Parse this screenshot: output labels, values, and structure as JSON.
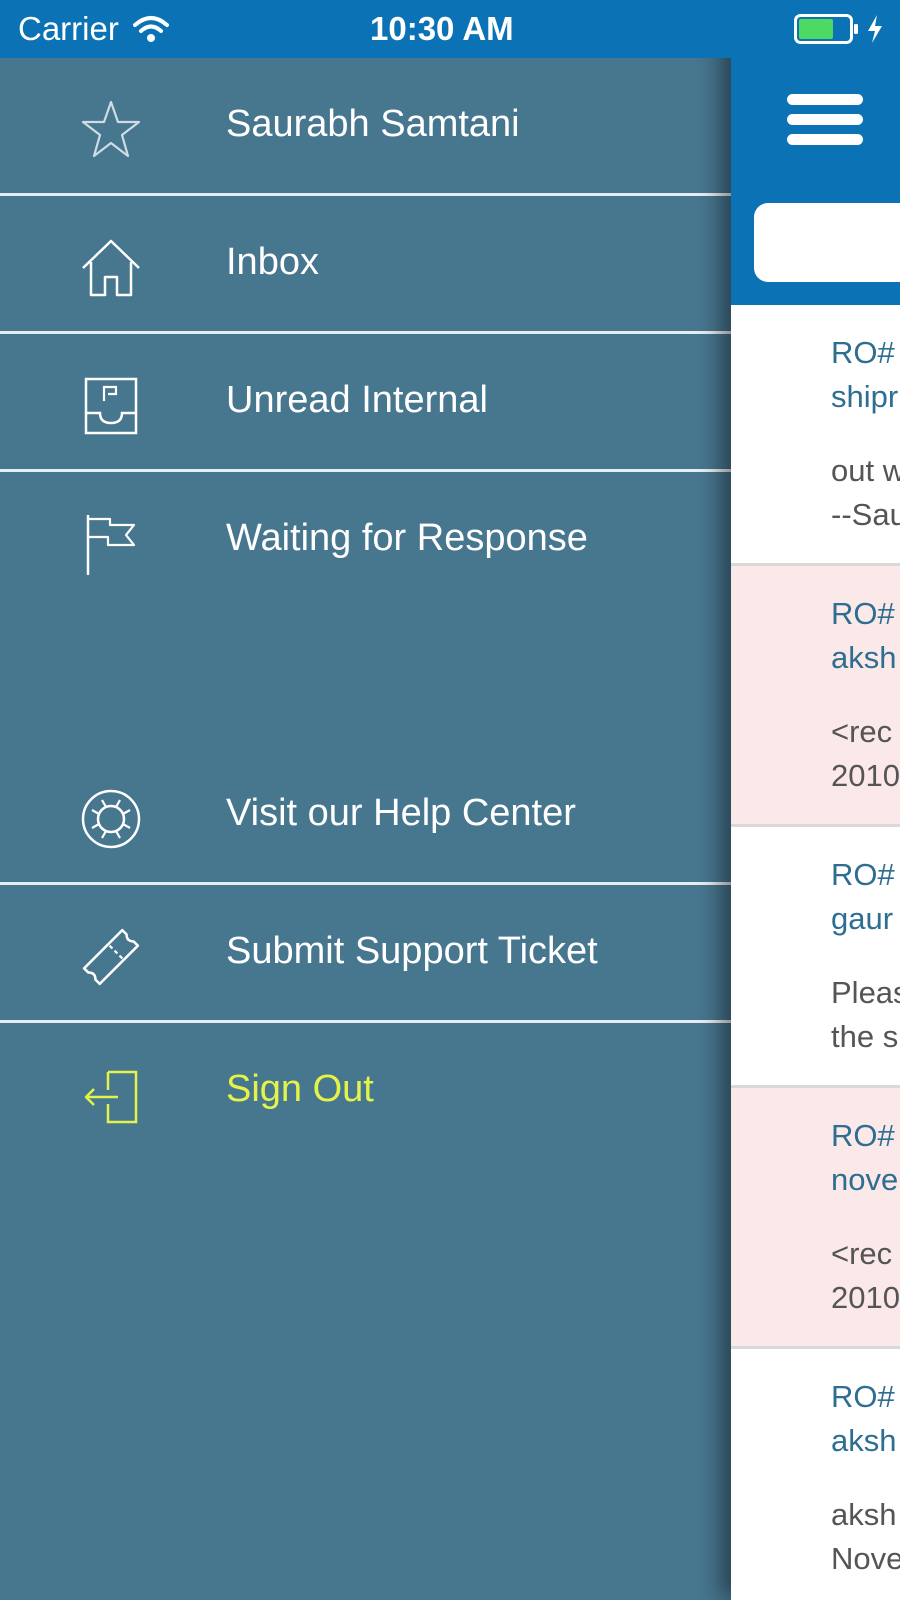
{
  "status_bar": {
    "carrier": "Carrier",
    "time": "10:30 AM",
    "battery_color": "#4cd964"
  },
  "menu": {
    "items": [
      {
        "label": "Saurabh Samtani",
        "icon": "star-icon"
      },
      {
        "label": "Inbox",
        "icon": "home-icon"
      },
      {
        "label": "Unread Internal",
        "icon": "inbox-tray-icon"
      },
      {
        "label": "Waiting for Response",
        "icon": "flag-icon"
      },
      {
        "label": "Visit our Help Center",
        "icon": "lifebuoy-icon"
      },
      {
        "label": "Submit Support Ticket",
        "icon": "ticket-icon"
      },
      {
        "label": "Sign Out",
        "icon": "sign-out-icon"
      }
    ]
  },
  "panel": {
    "header_color": "#0a72b5",
    "rows": [
      {
        "title1": "RO#",
        "title2": "shipr",
        "body1": "out w",
        "body2": "--Sau",
        "highlight": false
      },
      {
        "title1": "RO#",
        "title2": "aksh",
        "body1": "<rec",
        "body2": "2010",
        "highlight": true
      },
      {
        "title1": "RO#",
        "title2": "gaur",
        "body1": "Pleas",
        "body2": "the s",
        "highlight": false
      },
      {
        "title1": "RO#",
        "title2": "nove",
        "body1": "<rec",
        "body2": "2010",
        "highlight": true
      },
      {
        "title1": "RO#",
        "title2": "aksh",
        "body1": " aksh",
        "body2": "Nove",
        "highlight": false
      }
    ]
  },
  "colors": {
    "menu_bg": "#47768f",
    "accent_blue": "#0a72b5",
    "sign_out": "#e4f34a",
    "row_highlight": "#fbe8e9",
    "row_title": "#2d6e91"
  }
}
